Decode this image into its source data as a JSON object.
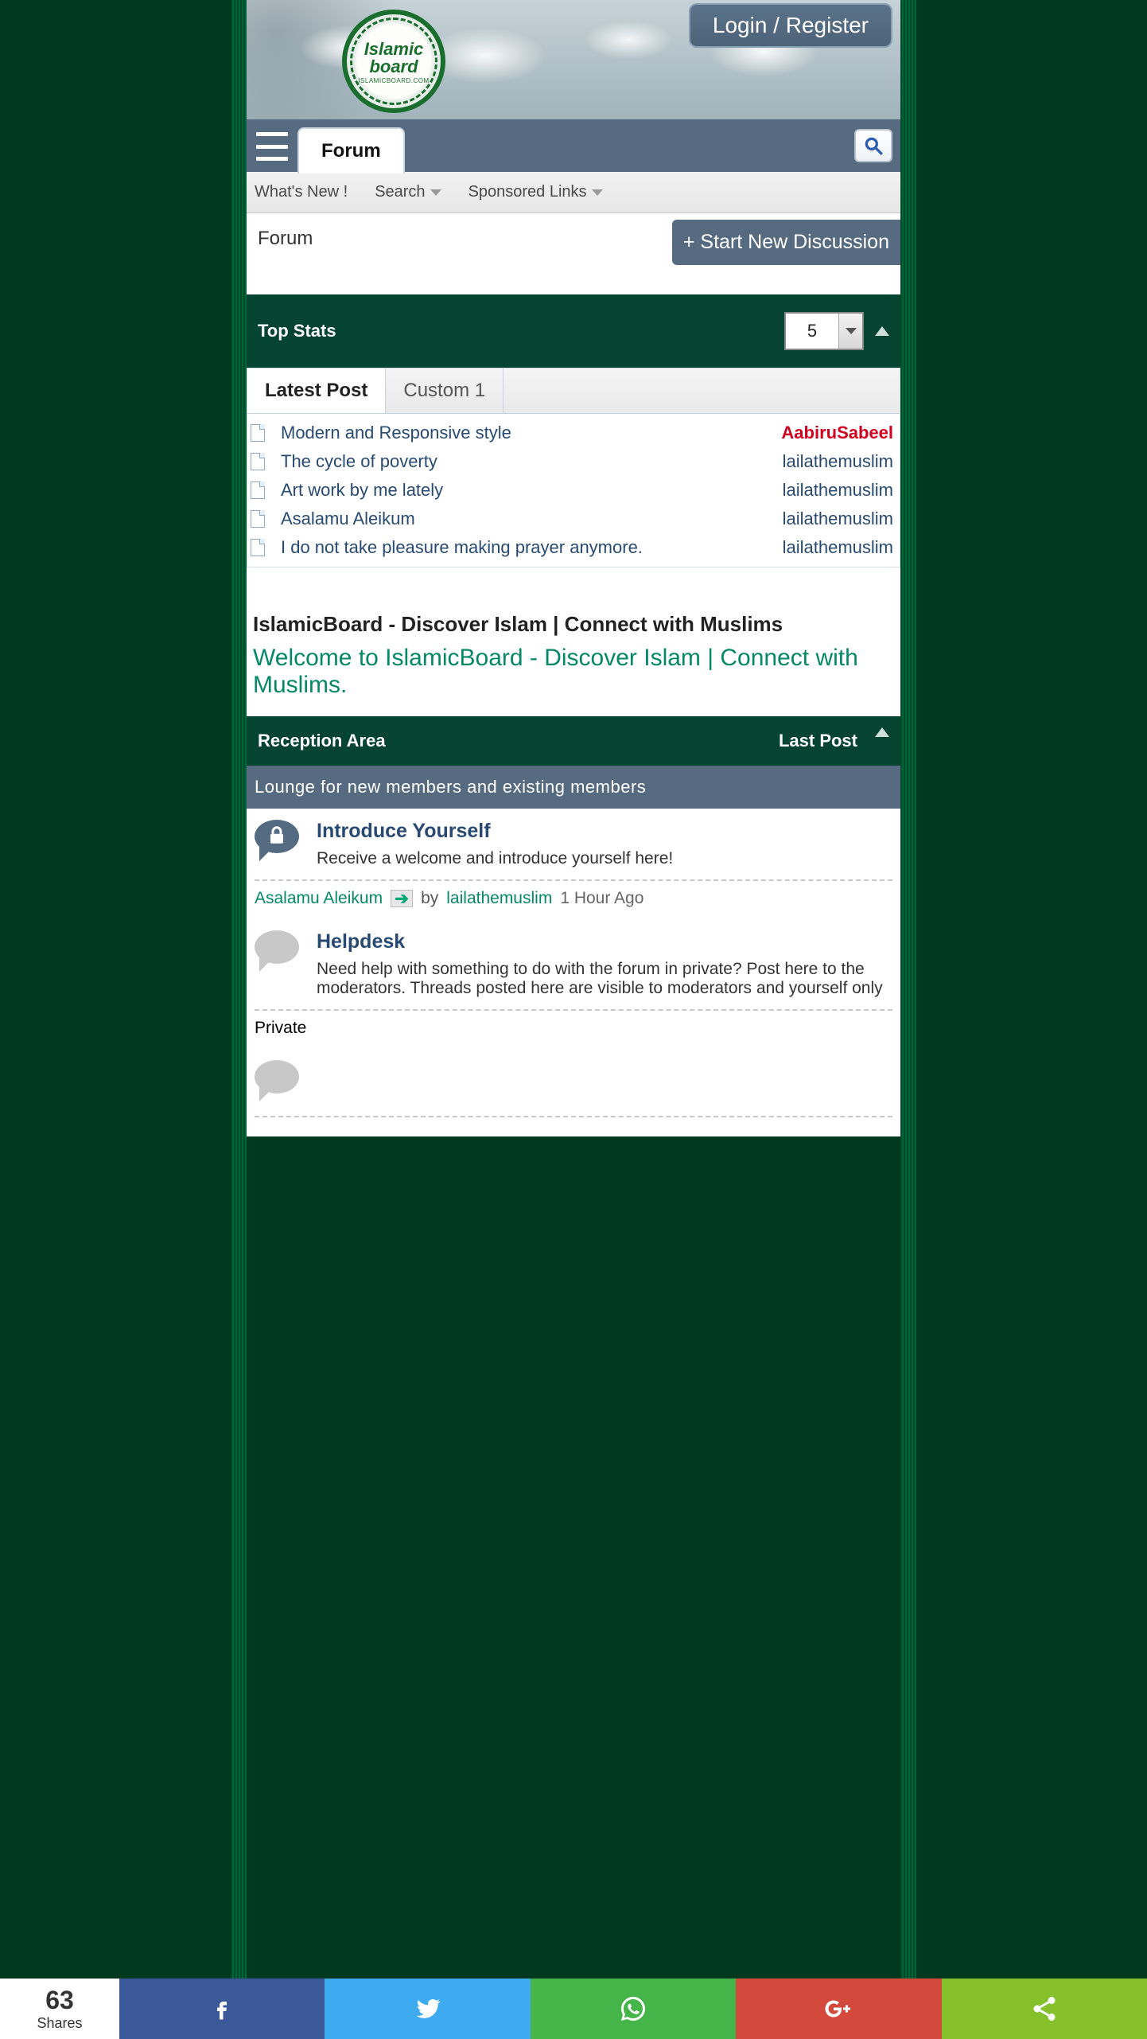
{
  "logo": {
    "line1": "Islamic",
    "line2": "board",
    "sub": "ISLAMICBOARD.COM"
  },
  "header": {
    "login": "Login / Register"
  },
  "nav": {
    "forum_tab": "Forum"
  },
  "subnav": {
    "whatsnew": "What's New !",
    "search": "Search",
    "sponsored": "Sponsored Links"
  },
  "breadcrumb": {
    "forum": "Forum",
    "new_discussion": "+ Start New Discussion"
  },
  "topstats": {
    "title": "Top Stats",
    "count": "5",
    "tabs": {
      "latest": "Latest Post",
      "custom1": "Custom 1"
    },
    "rows": [
      {
        "title": "Modern and Responsive style",
        "user": "AabiruSabeel",
        "hot": true
      },
      {
        "title": "The cycle of poverty",
        "user": "lailathemuslim",
        "hot": false
      },
      {
        "title": "Art work by me lately",
        "user": "lailathemuslim",
        "hot": false
      },
      {
        "title": "Asalamu Aleikum",
        "user": "lailathemuslim",
        "hot": false
      },
      {
        "title": "I do not take pleasure making prayer anymore.",
        "user": "lailathemuslim",
        "hot": false
      }
    ]
  },
  "board": {
    "title": "IslamicBoard - Discover Islam | Connect with Muslims",
    "welcome": "Welcome to IslamicBoard - Discover Islam | Connect with Muslims."
  },
  "section": {
    "name": "Reception Area",
    "lastpost": "Last Post",
    "sub": "Lounge for new members and existing members",
    "forums": [
      {
        "icon": "lock",
        "title": "Introduce Yourself",
        "desc": "Receive a welcome and introduce yourself here!",
        "last_thread": "Asalamu Aleikum",
        "by": "by",
        "last_user": "lailathemuslim",
        "last_time": "1 Hour Ago"
      },
      {
        "icon": "bubble",
        "title": "Helpdesk",
        "desc": "Need help with something to do with the forum in private? Post here to the moderators. Threads posted here are visible to moderators and yourself only",
        "last_thread": "Private",
        "by": "",
        "last_user": "",
        "last_time": ""
      },
      {
        "icon": "bubble",
        "title": "",
        "desc": "",
        "last_thread": "",
        "by": "",
        "last_user": "",
        "last_time": ""
      }
    ]
  },
  "share": {
    "count": "63",
    "label": "Shares"
  }
}
